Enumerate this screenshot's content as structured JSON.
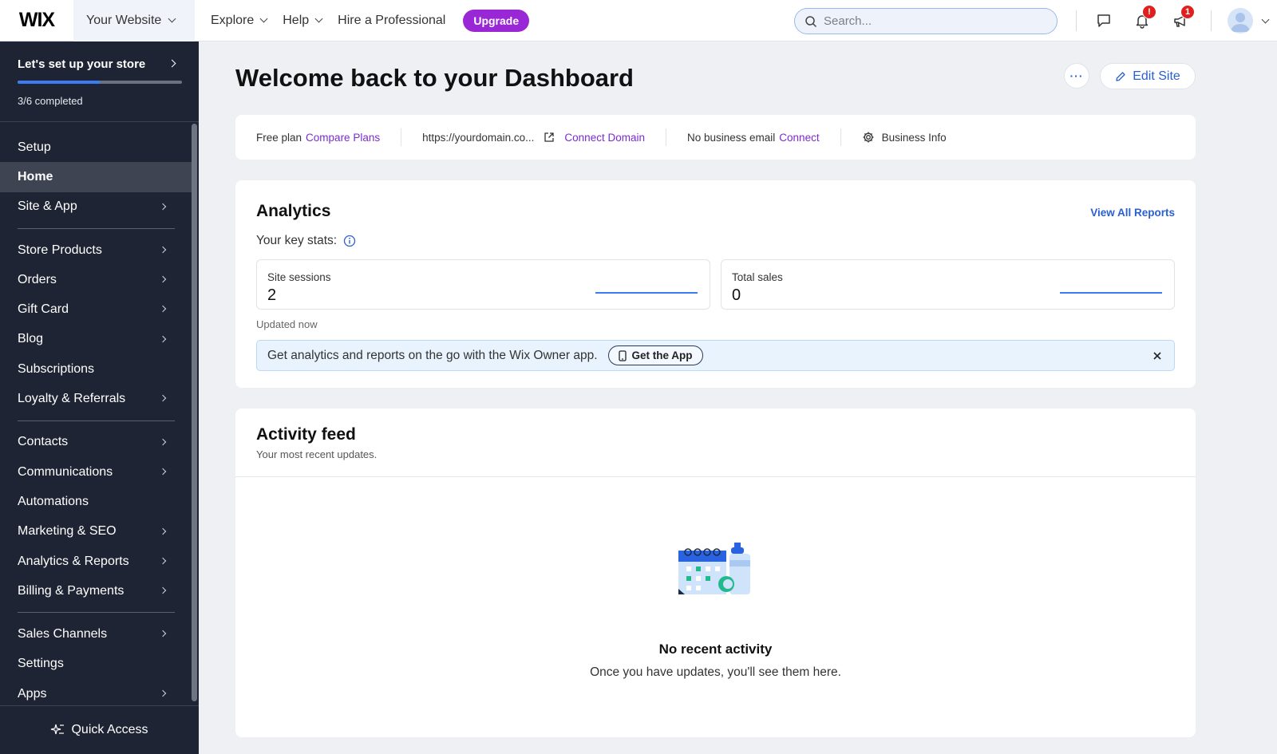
{
  "topbar": {
    "logo": "WIX",
    "site_name": "Your Website",
    "nav": [
      {
        "label": "Explore",
        "has_menu": true
      },
      {
        "label": "Help",
        "has_menu": true
      },
      {
        "label": "Hire a Professional",
        "has_menu": false
      }
    ],
    "upgrade_label": "Upgrade",
    "search_placeholder": "Search...",
    "notifications_badge": "!",
    "announcements_badge": "1"
  },
  "sidebar": {
    "setup_title": "Let's set up your store",
    "setup_progress_fraction": 0.5,
    "setup_count": "3/6 completed",
    "groups": [
      [
        {
          "label": "Setup",
          "arrow": false
        },
        {
          "label": "Home",
          "arrow": false,
          "active": true
        },
        {
          "label": "Site & App",
          "arrow": true
        }
      ],
      [
        {
          "label": "Store Products",
          "arrow": true
        },
        {
          "label": "Orders",
          "arrow": true
        },
        {
          "label": "Gift Card",
          "arrow": true
        },
        {
          "label": "Blog",
          "arrow": true
        },
        {
          "label": "Subscriptions",
          "arrow": false
        },
        {
          "label": "Loyalty & Referrals",
          "arrow": true
        }
      ],
      [
        {
          "label": "Contacts",
          "arrow": true
        },
        {
          "label": "Communications",
          "arrow": true
        },
        {
          "label": "Automations",
          "arrow": false
        },
        {
          "label": "Marketing & SEO",
          "arrow": true
        },
        {
          "label": "Analytics & Reports",
          "arrow": true
        },
        {
          "label": "Billing & Payments",
          "arrow": true
        }
      ],
      [
        {
          "label": "Sales Channels",
          "arrow": true
        },
        {
          "label": "Settings",
          "arrow": false
        },
        {
          "label": "Apps",
          "arrow": true
        }
      ]
    ],
    "quick_access": "Quick Access"
  },
  "main": {
    "title": "Welcome back to your Dashboard",
    "more_label": "···",
    "edit_site": "Edit Site",
    "infobar": {
      "plan": "Free plan",
      "compare": "Compare Plans",
      "domain": "https://yourdomain.co...",
      "connect_domain": "Connect Domain",
      "email": "No business email",
      "connect": "Connect",
      "business_info": "Business Info"
    },
    "analytics": {
      "title": "Analytics",
      "view_all": "View All Reports",
      "key_stats": "Your key stats:",
      "stats": [
        {
          "label": "Site sessions",
          "value": "2"
        },
        {
          "label": "Total sales",
          "value": "0"
        }
      ],
      "updated": "Updated now",
      "banner_text": "Get analytics and reports on the go with the Wix Owner app.",
      "get_app": "Get the App"
    },
    "activity": {
      "title": "Activity feed",
      "subtitle": "Your most recent updates.",
      "empty_title": "No recent activity",
      "empty_sub": "Once you have updates, you'll see them here."
    }
  },
  "colors": {
    "accent_blue": "#2a5fd4",
    "upgrade_purple": "#9a27d5",
    "link_purple": "#7b2bd1",
    "sidebar_bg": "#1e2433",
    "badge_red": "#e01f1f"
  }
}
